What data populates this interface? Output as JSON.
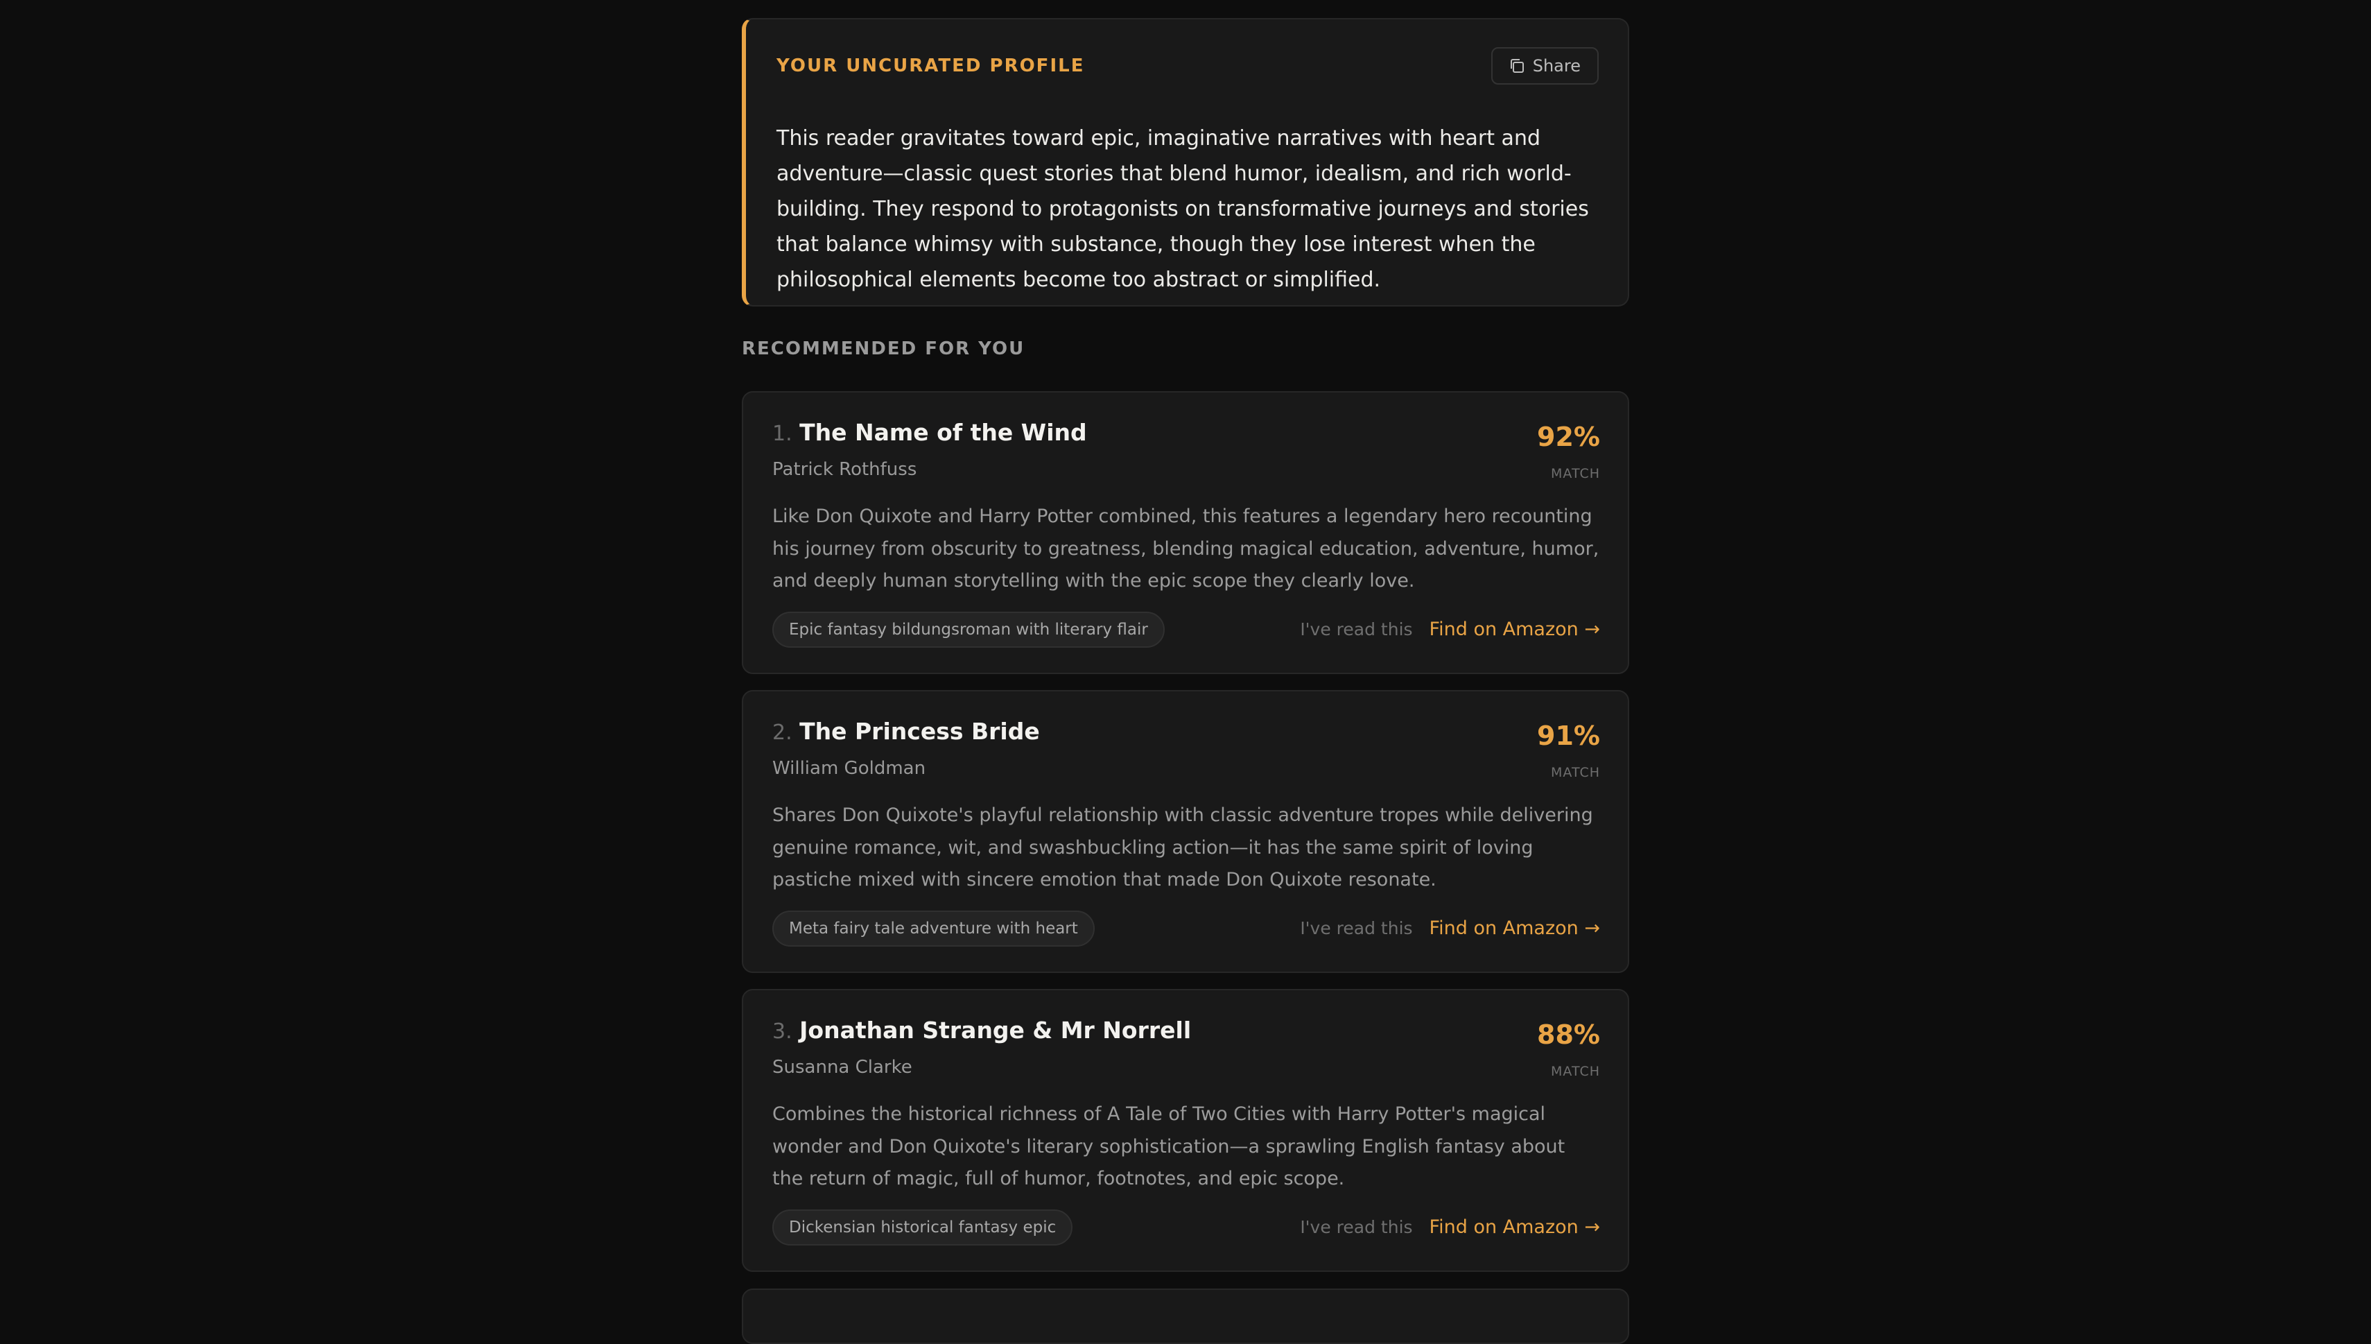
{
  "profile": {
    "heading": "YOUR UNCURATED PROFILE",
    "share_label": "Share",
    "share_icon": "copy-icon",
    "text": "This reader gravitates toward epic, imaginative narratives with heart and adventure—classic quest stories that blend humor, idealism, and rich world-building. They respond to protagonists on transformative journeys and stories that balance whimsy with substance, though they lose interest when the philosophical elements become too abstract or simplified."
  },
  "recommendations": {
    "heading": "RECOMMENDED FOR YOU",
    "items": [
      {
        "number": "1.",
        "title": "The Name of the Wind",
        "author": "Patrick Rothfuss",
        "match": "92%",
        "match_label": "MATCH",
        "description": "Like Don Quixote and Harry Potter combined, this features a legendary hero recounting his journey from obscurity to greatness, blending magical education, adventure, humor, and deeply human storytelling with the epic scope they clearly love.",
        "tag": "Epic fantasy bildungsroman with literary flair",
        "read_label": "I've read this",
        "amazon_label": "Find on Amazon →"
      },
      {
        "number": "2.",
        "title": "The Princess Bride",
        "author": "William Goldman",
        "match": "91%",
        "match_label": "MATCH",
        "description": "Shares Don Quixote's playful relationship with classic adventure tropes while delivering genuine romance, wit, and swashbuckling action—it has the same spirit of loving pastiche mixed with sincere emotion that made Don Quixote resonate.",
        "tag": "Meta fairy tale adventure with heart",
        "read_label": "I've read this",
        "amazon_label": "Find on Amazon →"
      },
      {
        "number": "3.",
        "title": "Jonathan Strange & Mr Norrell",
        "author": "Susanna Clarke",
        "match": "88%",
        "match_label": "MATCH",
        "description": "Combines the historical richness of A Tale of Two Cities with Harry Potter's magical wonder and Don Quixote's literary sophistication—a sprawling English fantasy about the return of magic, full of humor, footnotes, and epic scope.",
        "tag": "Dickensian historical fantasy epic",
        "read_label": "I've read this",
        "amazon_label": "Find on Amazon →"
      }
    ]
  },
  "colors": {
    "accent": "#e9a446",
    "background": "#0d0d0d",
    "card": "#191919"
  }
}
